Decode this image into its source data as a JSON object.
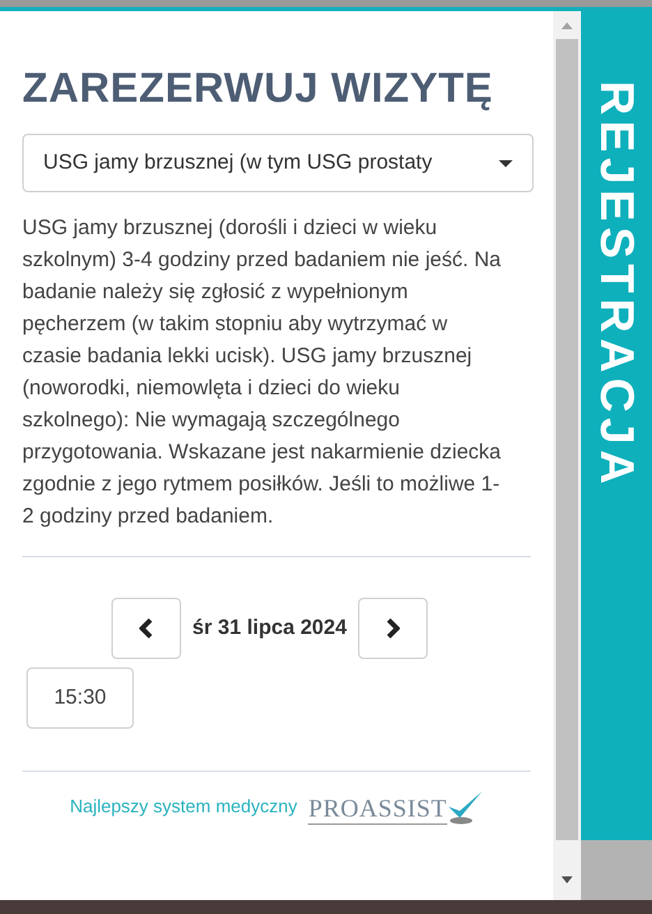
{
  "title": "ZAREZERWUJ WIZYTĘ",
  "service_select": {
    "value": "USG jamy brzusznej (w tym USG prostaty"
  },
  "description": "USG jamy brzusznej (dorośli i dzieci w wieku szkolnym) 3-4 godziny przed badaniem nie jeść. Na badanie należy się zgłosić z wypełnionym pęcherzem (w takim stopniu aby wytrzymać w czasie badania lekki ucisk). USG jamy brzusznej (noworodki, niemowlęta i dzieci do wieku szkolnego): Nie wymagają szczególnego przygotowania. Wskazane jest nakarmienie dziecka zgodnie z jego rytmem posiłków. Jeśli to możliwe 1-2 godziny przed badaniem.",
  "date": "śr 31 lipca 2024",
  "time_slots": [
    "15:30"
  ],
  "footer": {
    "text": "Najlepszy system medyczny",
    "logo": "PROASSIST"
  },
  "side_tab": "REJESTRACJA"
}
